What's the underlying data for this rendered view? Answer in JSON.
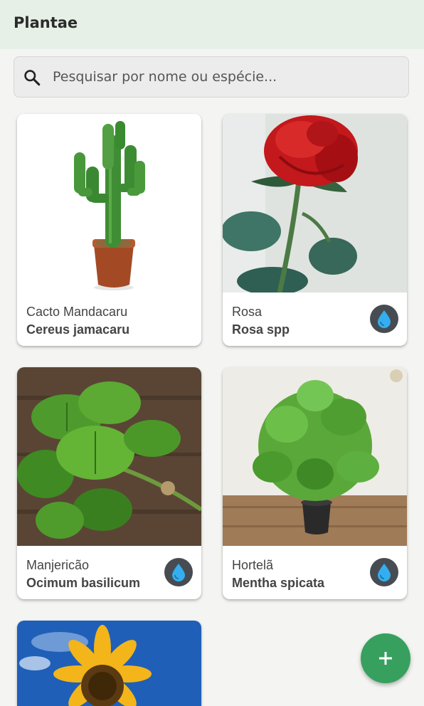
{
  "app": {
    "title": "Plantae"
  },
  "search": {
    "placeholder": "Pesquisar por nome ou espécie...",
    "value": "",
    "icon": "search-icon"
  },
  "plants": [
    {
      "common_name": "Cacto Mandacaru",
      "species": "Cereus jamacaru",
      "needs_water": false
    },
    {
      "common_name": "Rosa",
      "species": "Rosa spp",
      "needs_water": true
    },
    {
      "common_name": "Manjericão",
      "species": "Ocimum basilicum",
      "needs_water": true
    },
    {
      "common_name": "Hortelã",
      "species": "Mentha spicata",
      "needs_water": true
    },
    {
      "common_name": "",
      "species": "",
      "needs_water": false
    }
  ],
  "fab": {
    "icon": "plus-icon",
    "color": "#37a05f"
  },
  "colors": {
    "appbar": "#e7f0e6",
    "background": "#f4f5f2",
    "water_badge": "#474c52",
    "water_drop": "#33aef0"
  }
}
